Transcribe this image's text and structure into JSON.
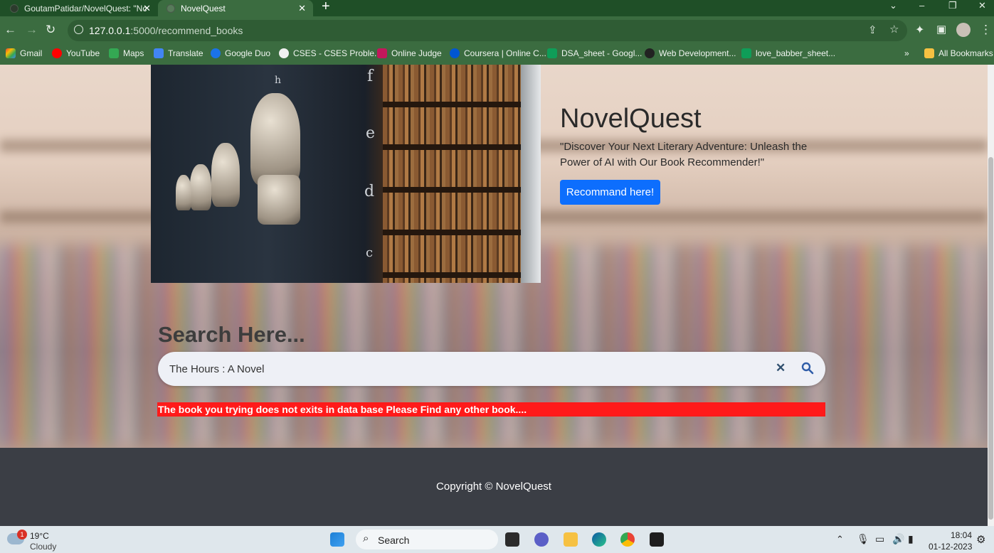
{
  "browser": {
    "tabs": [
      {
        "label": "GoutamPatidar/NovelQuest: \"Nc",
        "active": false
      },
      {
        "label": "NovelQuest",
        "active": true
      }
    ],
    "url_host": "127.0.0.1",
    "url_path": ":5000/recommend_books",
    "bookmarks": [
      "Gmail",
      "YouTube",
      "Maps",
      "Translate",
      "Google Duo",
      "CSES - CSES Proble...",
      "Online Judge",
      "Coursera | Online C...",
      "DSA_sheet - Googl...",
      "Web Development...",
      "love_babber_sheet..."
    ],
    "all_bookmarks": "All Bookmarks",
    "overflow": "»"
  },
  "hero": {
    "title": "NovelQuest",
    "tagline": "\"Discover Your Next Literary Adventure: Unleash the Power of AI with Our Book Recommender!\"",
    "cta_label": "Recommand here!",
    "photo_letters": [
      "f",
      "h",
      "e",
      "d",
      "c"
    ]
  },
  "search": {
    "heading": "Search Here...",
    "value": "The Hours : A Novel",
    "clear_label": "✕",
    "error": "The book you trying does not exits in data base Please Find any other book...."
  },
  "footer": {
    "copyright": "Copyright © NovelQuest"
  },
  "taskbar": {
    "weather_temp": "19°C",
    "weather_desc": "Cloudy",
    "weather_badge": "1",
    "search_label": "Search",
    "time": "18:04",
    "date": "01-12-2023"
  },
  "colors": {
    "accent": "#0d6efd",
    "error": "#ff1a1a",
    "footer": "#3b3e45",
    "chrome": "#3b6c40"
  }
}
